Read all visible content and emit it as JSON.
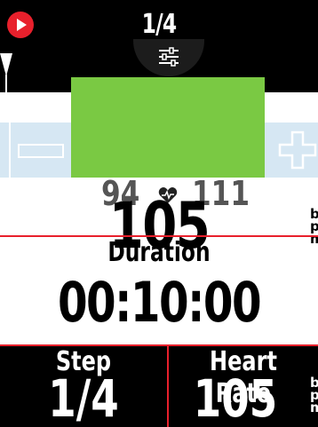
{
  "header": {
    "page_indicator": "1/4",
    "play_icon": "play-icon",
    "settings_icon": "sliders-icon"
  },
  "colors": {
    "accent_red": "#e8202c",
    "zone_green": "#7ac943",
    "zone_blue": "#d6e7f3",
    "background_dark": "#000000"
  },
  "zone": {
    "minus_icon": "minus-icon",
    "plus_icon": "plus-icon"
  },
  "heart_rate_target": {
    "low": "94",
    "high": "111",
    "icon": "heart-icon",
    "current": "105",
    "unit_lines": [
      "b",
      "p",
      "m"
    ]
  },
  "duration": {
    "label": "Duration",
    "value": "00:10:00"
  },
  "bottom": {
    "step_label": "Step",
    "step_value": "1/4",
    "hr_label": "Heart Rate",
    "hr_value": "105",
    "unit_lines": [
      "b",
      "p",
      "m"
    ]
  }
}
